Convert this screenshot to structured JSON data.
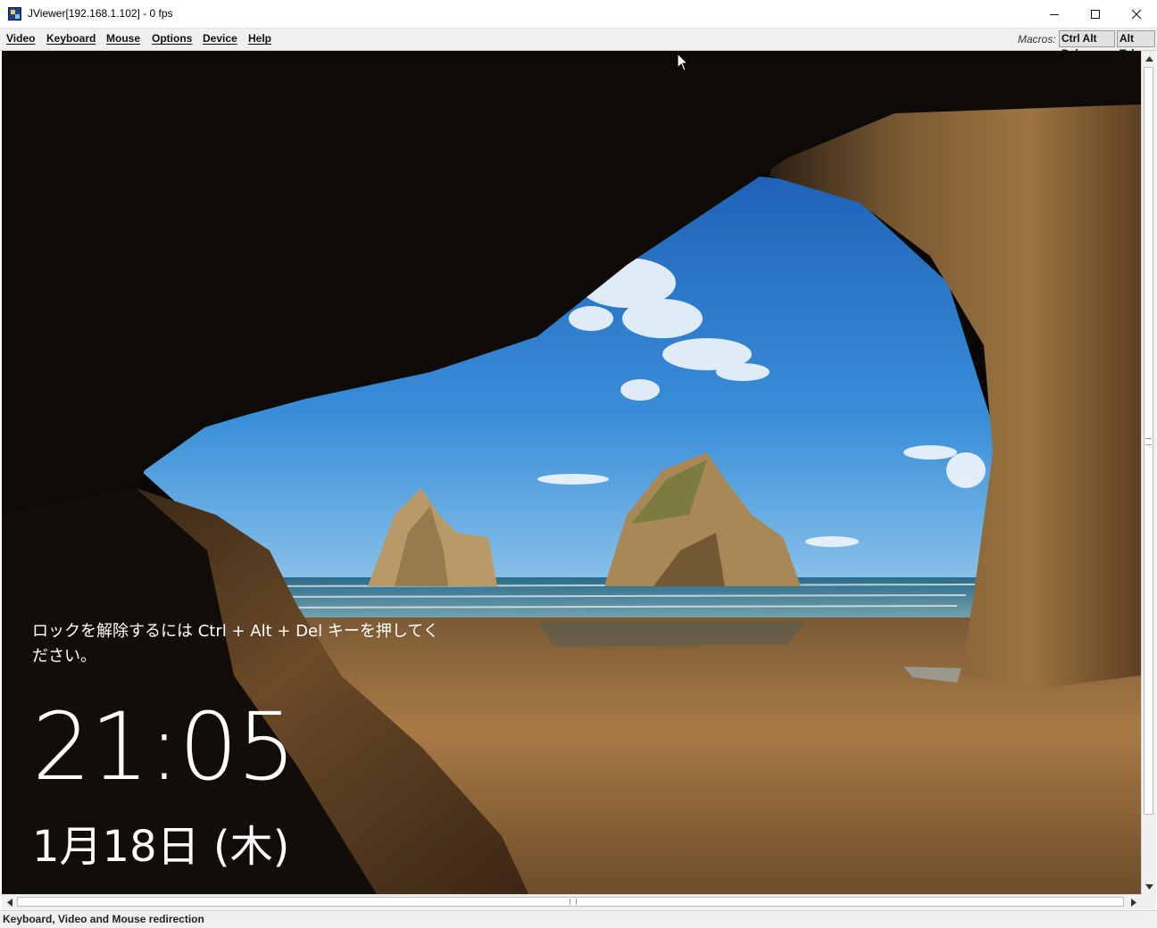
{
  "window": {
    "title": "JViewer[192.168.1.102] - 0 fps",
    "app_icon": "jviewer-app-icon",
    "controls": [
      "minimize-icon",
      "maximize-icon",
      "close-icon"
    ]
  },
  "menubar": {
    "items": [
      {
        "label": "Video"
      },
      {
        "label": "Keyboard"
      },
      {
        "label": "Mouse"
      },
      {
        "label": "Options"
      },
      {
        "label": "Device"
      },
      {
        "label": "Help"
      }
    ],
    "macros_label": "Macros:",
    "macros": [
      {
        "label": "Ctrl Alt Del"
      },
      {
        "label": "Alt Tab"
      }
    ]
  },
  "remote_screen": {
    "lock_message": "ロックを解除するには Ctrl + Alt + Del キーを押してください。",
    "time": "21:05",
    "date": "1月18日 (木)",
    "background": "windows-lock-screen-sea-cave-beach"
  },
  "statusbar": {
    "text": "Keyboard, Video and Mouse redirection"
  },
  "colors": {
    "titlebar_bg": "#ffffff",
    "menubar_bg": "#f0f0f0",
    "lock_text": "#ffffff",
    "cave": "#0a0806",
    "sky": "#2e7fd0"
  }
}
